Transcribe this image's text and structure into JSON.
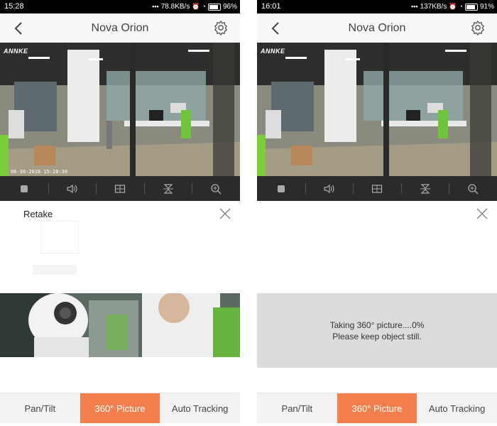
{
  "screens": [
    {
      "status": {
        "time": "15:28",
        "network": "78.8KB/s",
        "battery_pct": "96%"
      },
      "header": {
        "title": "Nova Orion"
      },
      "video": {
        "brand": "ANNKE",
        "timestamp": "06-30-2018 15:28:30"
      },
      "panel": {
        "retake_label": "Retake"
      },
      "tabs": [
        {
          "label": "Pan/Tilt"
        },
        {
          "label": "360° Picture"
        },
        {
          "label": "Auto Tracking"
        }
      ]
    },
    {
      "status": {
        "time": "16:01",
        "network": "137KB/s",
        "battery_pct": "91%"
      },
      "header": {
        "title": "Nova Orion"
      },
      "video": {
        "brand": "ANNKE"
      },
      "panel": {
        "progress_line1": "Taking 360° picture....0%",
        "progress_line2": "Please keep object still."
      },
      "tabs": [
        {
          "label": "Pan/Tilt"
        },
        {
          "label": "360° Picture"
        },
        {
          "label": "Auto Tracking"
        }
      ]
    }
  ],
  "icons": {
    "back": "chevron-left-icon",
    "settings": "gear-icon",
    "stop": "stop-icon",
    "sound": "speaker-icon",
    "layout": "grid-icon",
    "flip": "flip-icon",
    "zoom": "zoom-in-icon",
    "close": "close-icon"
  },
  "colors": {
    "accent": "#f47f4e",
    "controls_bg": "#2b2b2b",
    "progress_bg": "#dcdcdc"
  }
}
